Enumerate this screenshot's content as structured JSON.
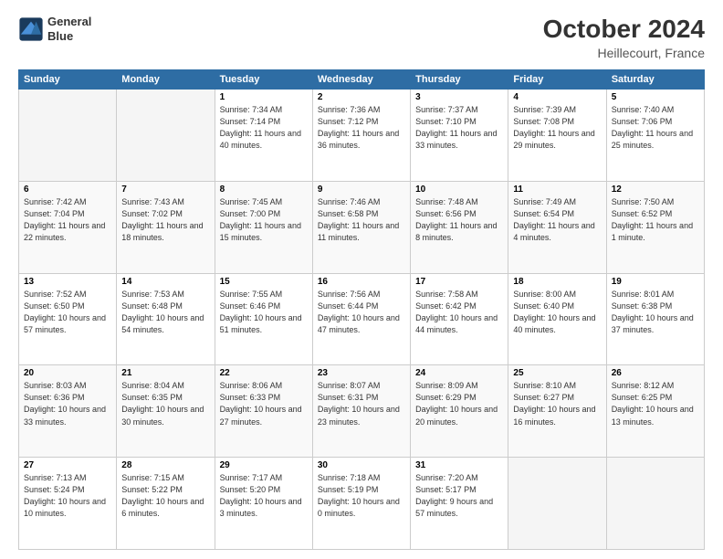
{
  "logo": {
    "line1": "General",
    "line2": "Blue"
  },
  "title": "October 2024",
  "subtitle": "Heillecourt, France",
  "days_of_week": [
    "Sunday",
    "Monday",
    "Tuesday",
    "Wednesday",
    "Thursday",
    "Friday",
    "Saturday"
  ],
  "weeks": [
    [
      {
        "day": "",
        "empty": true
      },
      {
        "day": "",
        "empty": true
      },
      {
        "day": "1",
        "sunrise": "7:34 AM",
        "sunset": "7:14 PM",
        "daylight": "11 hours and 40 minutes."
      },
      {
        "day": "2",
        "sunrise": "7:36 AM",
        "sunset": "7:12 PM",
        "daylight": "11 hours and 36 minutes."
      },
      {
        "day": "3",
        "sunrise": "7:37 AM",
        "sunset": "7:10 PM",
        "daylight": "11 hours and 33 minutes."
      },
      {
        "day": "4",
        "sunrise": "7:39 AM",
        "sunset": "7:08 PM",
        "daylight": "11 hours and 29 minutes."
      },
      {
        "day": "5",
        "sunrise": "7:40 AM",
        "sunset": "7:06 PM",
        "daylight": "11 hours and 25 minutes."
      }
    ],
    [
      {
        "day": "6",
        "sunrise": "7:42 AM",
        "sunset": "7:04 PM",
        "daylight": "11 hours and 22 minutes."
      },
      {
        "day": "7",
        "sunrise": "7:43 AM",
        "sunset": "7:02 PM",
        "daylight": "11 hours and 18 minutes."
      },
      {
        "day": "8",
        "sunrise": "7:45 AM",
        "sunset": "7:00 PM",
        "daylight": "11 hours and 15 minutes."
      },
      {
        "day": "9",
        "sunrise": "7:46 AM",
        "sunset": "6:58 PM",
        "daylight": "11 hours and 11 minutes."
      },
      {
        "day": "10",
        "sunrise": "7:48 AM",
        "sunset": "6:56 PM",
        "daylight": "11 hours and 8 minutes."
      },
      {
        "day": "11",
        "sunrise": "7:49 AM",
        "sunset": "6:54 PM",
        "daylight": "11 hours and 4 minutes."
      },
      {
        "day": "12",
        "sunrise": "7:50 AM",
        "sunset": "6:52 PM",
        "daylight": "11 hours and 1 minute."
      }
    ],
    [
      {
        "day": "13",
        "sunrise": "7:52 AM",
        "sunset": "6:50 PM",
        "daylight": "10 hours and 57 minutes."
      },
      {
        "day": "14",
        "sunrise": "7:53 AM",
        "sunset": "6:48 PM",
        "daylight": "10 hours and 54 minutes."
      },
      {
        "day": "15",
        "sunrise": "7:55 AM",
        "sunset": "6:46 PM",
        "daylight": "10 hours and 51 minutes."
      },
      {
        "day": "16",
        "sunrise": "7:56 AM",
        "sunset": "6:44 PM",
        "daylight": "10 hours and 47 minutes."
      },
      {
        "day": "17",
        "sunrise": "7:58 AM",
        "sunset": "6:42 PM",
        "daylight": "10 hours and 44 minutes."
      },
      {
        "day": "18",
        "sunrise": "8:00 AM",
        "sunset": "6:40 PM",
        "daylight": "10 hours and 40 minutes."
      },
      {
        "day": "19",
        "sunrise": "8:01 AM",
        "sunset": "6:38 PM",
        "daylight": "10 hours and 37 minutes."
      }
    ],
    [
      {
        "day": "20",
        "sunrise": "8:03 AM",
        "sunset": "6:36 PM",
        "daylight": "10 hours and 33 minutes."
      },
      {
        "day": "21",
        "sunrise": "8:04 AM",
        "sunset": "6:35 PM",
        "daylight": "10 hours and 30 minutes."
      },
      {
        "day": "22",
        "sunrise": "8:06 AM",
        "sunset": "6:33 PM",
        "daylight": "10 hours and 27 minutes."
      },
      {
        "day": "23",
        "sunrise": "8:07 AM",
        "sunset": "6:31 PM",
        "daylight": "10 hours and 23 minutes."
      },
      {
        "day": "24",
        "sunrise": "8:09 AM",
        "sunset": "6:29 PM",
        "daylight": "10 hours and 20 minutes."
      },
      {
        "day": "25",
        "sunrise": "8:10 AM",
        "sunset": "6:27 PM",
        "daylight": "10 hours and 16 minutes."
      },
      {
        "day": "26",
        "sunrise": "8:12 AM",
        "sunset": "6:25 PM",
        "daylight": "10 hours and 13 minutes."
      }
    ],
    [
      {
        "day": "27",
        "sunrise": "7:13 AM",
        "sunset": "5:24 PM",
        "daylight": "10 hours and 10 minutes."
      },
      {
        "day": "28",
        "sunrise": "7:15 AM",
        "sunset": "5:22 PM",
        "daylight": "10 hours and 6 minutes."
      },
      {
        "day": "29",
        "sunrise": "7:17 AM",
        "sunset": "5:20 PM",
        "daylight": "10 hours and 3 minutes."
      },
      {
        "day": "30",
        "sunrise": "7:18 AM",
        "sunset": "5:19 PM",
        "daylight": "10 hours and 0 minutes."
      },
      {
        "day": "31",
        "sunrise": "7:20 AM",
        "sunset": "5:17 PM",
        "daylight": "9 hours and 57 minutes."
      },
      {
        "day": "",
        "empty": true
      },
      {
        "day": "",
        "empty": true
      }
    ]
  ]
}
